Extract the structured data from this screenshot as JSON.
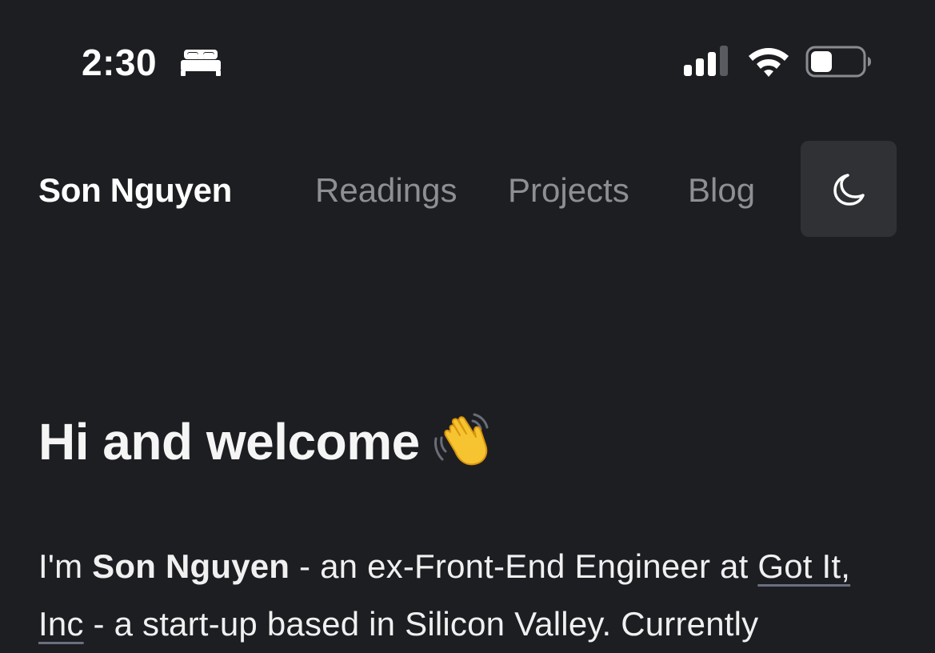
{
  "status_bar": {
    "time": "2:30",
    "focus_icon": "bed-icon",
    "signal_icon": "cellular-signal-icon",
    "wifi_icon": "wifi-icon",
    "battery_icon": "battery-icon",
    "battery_level": 0.35
  },
  "nav": {
    "site_name": "Son Nguyen",
    "links": [
      {
        "label": "Readings"
      },
      {
        "label": "Projects"
      },
      {
        "label": "Blog"
      }
    ],
    "theme_toggle_icon": "moon-icon"
  },
  "main": {
    "heading": "Hi and welcome",
    "heading_emoji": "waving-hand-icon",
    "intro": {
      "prefix": "I'm ",
      "name": "Son Nguyen",
      "middle": " - an ex-Front-End Engineer at ",
      "company": "Got It, Inc",
      "suffix": " - a start-up based in Silicon Valley. Currently"
    }
  },
  "colors": {
    "background": "#1d1e22",
    "text": "#f2f2f2",
    "nav_link": "#8e8f94",
    "toggle_bg": "#303135",
    "wave_yellow": "#f7c431"
  }
}
